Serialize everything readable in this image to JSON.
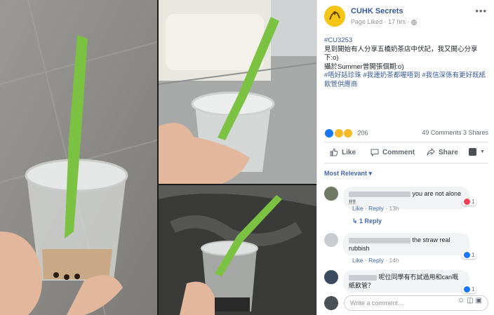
{
  "page": {
    "name": "CUHK Secrets",
    "liked_status": "Page Liked",
    "time": "17 hrs",
    "more_icon": "ellipsis-icon",
    "globe_icon": "globe-icon"
  },
  "post": {
    "hashtag": "#CU3253",
    "line1": "見到開始有人分享五橋奶茶店中伏記，我又開心分享下:o)",
    "line2": "攝於Summer曾開張個期:o)",
    "tags": "#唔好話珍珠 #我連奶茶都喔唔到 #我信深係有更好既紙飲管供應商"
  },
  "reactions": {
    "count": "206",
    "comments": "49 Comments",
    "shares": "3 Shares",
    "colors": {
      "like": "#1877f2",
      "haha": "#f7b928",
      "wow": "#f7b928"
    }
  },
  "actions": {
    "like": "Like",
    "comment": "Comment",
    "share": "Share"
  },
  "sort_label": "Most Relevant ▾",
  "comments": [
    {
      "text": "you are not alone !!!!",
      "like_label": "Like",
      "reply_label": "Reply",
      "time": "13h",
      "reaction_count": "1",
      "reaction_color": "#f33e58"
    },
    {
      "text_a": "the straw real",
      "text_b": "rubbish",
      "like_label": "Like",
      "reply_label": "Reply",
      "time": "14h",
      "reaction_count": "1",
      "reaction_color": "#1877f2"
    },
    {
      "text": "呢位同學有冇試過用和can嘅紙飲管？",
      "reaction_count": "1",
      "reaction_color": "#1877f2"
    }
  ],
  "replies_label": "1 Reply",
  "write_placeholder": "Write a comment...",
  "brand_color": "#365899"
}
